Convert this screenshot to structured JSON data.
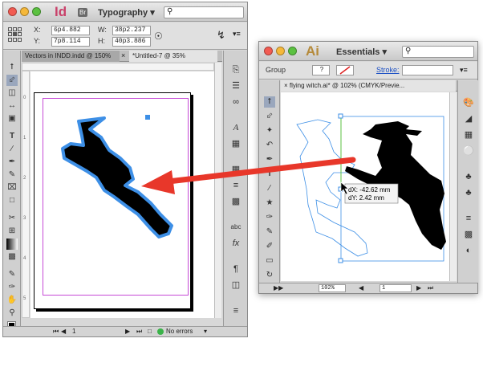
{
  "indesign": {
    "app_logo": "Id",
    "bridge_badge": "Br",
    "workspace": "Typography",
    "fields": {
      "x_label": "X:",
      "x_value": "6p4.882",
      "y_label": "Y:",
      "y_value": "7p8.114",
      "w_label": "W:",
      "w_value": "38p2.237",
      "h_label": "H:",
      "h_value": "40p3.886"
    },
    "tabs": [
      "Vectors in INDD.indd @ 150%",
      "*Untitled-7 @ 35%"
    ],
    "tab_close": "×",
    "page_number": "1",
    "preflight_status": "No errors",
    "ruler_marks": [
      "0",
      "1",
      "2",
      "3",
      "4",
      "5",
      "6"
    ]
  },
  "illustrator": {
    "app_logo": "Ai",
    "workspace": "Essentials",
    "control_label": "Group",
    "stroke_label": "Stroke:",
    "doc_tab": "flying witch.ai* @ 102% (CMYK/Previe...",
    "measure_dx": "dX: -42.62 mm",
    "measure_dy": "dY: 2.42 mm",
    "zoom": "102%",
    "artboard": "1",
    "question": "?"
  },
  "colors": {
    "arrow": "#e8372a",
    "selection_blue": "#3d8fe6",
    "frame_magenta": "#c64ad6",
    "witch_black": "#000000"
  },
  "icons": {
    "indesign_tools": [
      "selection-icon",
      "direct-selection-icon",
      "page-tool-icon",
      "gap-tool-icon",
      "content-collector-icon",
      "type-icon",
      "line-icon",
      "pen-icon",
      "pencil-icon",
      "rectangle-frame-icon",
      "rectangle-icon",
      "scissors-icon",
      "free-transform-icon",
      "gradient-swatch-icon",
      "gradient-feather-icon",
      "note-icon",
      "eyedropper-icon",
      "hand-icon",
      "zoom-icon"
    ],
    "indesign_panels": [
      "pages-icon",
      "layers-icon",
      "links-icon",
      "character-icon",
      "paragraph-styles-icon",
      "swatches-icon",
      "stroke-icon",
      "gradient-icon",
      "glyphs-icon",
      "effects-icon",
      "object-styles-icon",
      "text-wrap-icon",
      "align-icon"
    ],
    "illustrator_tools": [
      "selection-icon",
      "direct-selection-icon",
      "magic-wand-icon",
      "lasso-icon",
      "pen-icon",
      "type-icon",
      "line-icon",
      "rectangle-icon",
      "paintbrush-icon",
      "pencil-icon",
      "blob-brush-icon",
      "eraser-icon",
      "rotate-icon",
      "scale-icon"
    ],
    "illustrator_panels": [
      "color-icon",
      "color-guide-icon",
      "swatches-icon",
      "brushes-icon",
      "symbols-icon",
      "stroke-icon",
      "gradient-icon",
      "transparency-icon",
      "appearance-icon"
    ]
  }
}
